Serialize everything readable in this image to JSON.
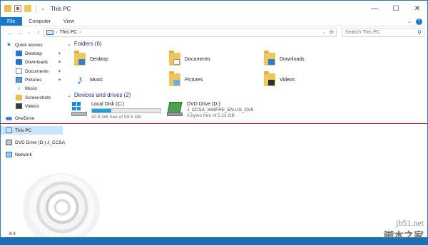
{
  "window": {
    "title": "This PC",
    "controls": {
      "minimize": "—",
      "maximize": "☐",
      "close": "✕"
    }
  },
  "ribbon": {
    "tabs": [
      "File",
      "Computer",
      "View"
    ],
    "expand": "⌄",
    "help": "?"
  },
  "address": {
    "back": "←",
    "forward": "→",
    "recent": "⌄",
    "up": "↑",
    "crumb_sep": "›",
    "path": "This PC",
    "path_sep": "›",
    "dropdown": "⌄",
    "refresh": "⟳"
  },
  "search": {
    "placeholder": "Search This PC",
    "icon": "⚲"
  },
  "nav": {
    "quick_access": "Quick access",
    "items": [
      {
        "label": "Desktop",
        "pinned": true
      },
      {
        "label": "Downloads",
        "pinned": true
      },
      {
        "label": "Documents",
        "pinned": true
      },
      {
        "label": "Pictures",
        "pinned": true
      },
      {
        "label": "Music",
        "pinned": false
      },
      {
        "label": "Screenshots",
        "pinned": false
      },
      {
        "label": "Videos",
        "pinned": false
      }
    ],
    "pin_glyph": "✦",
    "onedrive": "OneDrive",
    "this_pc": "This PC",
    "dvd": "DVD Drive (D:) J_CCSA",
    "network": "Network"
  },
  "content": {
    "folders_header": "Folders (6)",
    "folders": [
      "Desktop",
      "Documents",
      "Downloads",
      "Music",
      "Pictures",
      "Videos"
    ],
    "drives_header": "Devices and drives (2)",
    "drives": [
      {
        "name": "Local Disk (C:)",
        "free": "42.9 GB free of 59.5 GB",
        "used_fraction": 0.28
      },
      {
        "name": "DVD Drive (D:)",
        "label": "J_CCSA_X64FRE_EN-US_DV5",
        "free": "0 bytes free of 5.23 GB"
      }
    ],
    "chevron": "⌄"
  },
  "status": {
    "items": "8 it"
  },
  "watermark": {
    "line1": "jb51.net",
    "line2": "脚本之家"
  },
  "colors": {
    "accent": "#1979ca",
    "annotation": "#c8161d",
    "header_text": "#1e3287"
  }
}
